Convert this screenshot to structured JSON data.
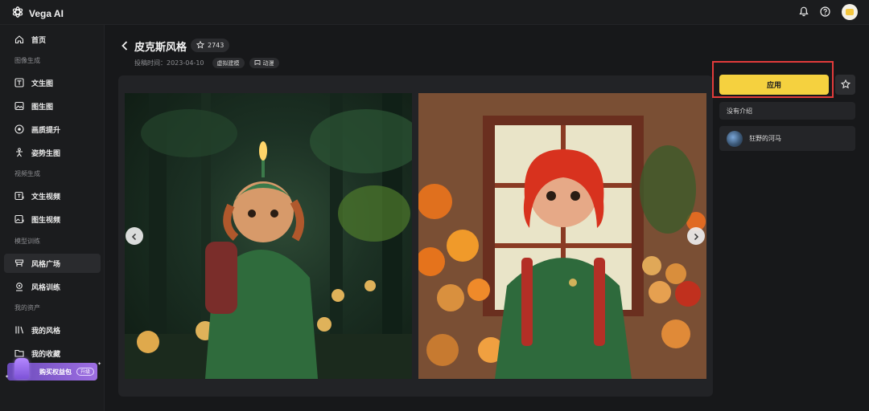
{
  "app": {
    "name": "Vega AI"
  },
  "sidebar": {
    "items": [
      {
        "label": "首页",
        "icon": "home-icon"
      },
      {
        "section": "图像生成"
      },
      {
        "label": "文生图",
        "icon": "text-icon"
      },
      {
        "label": "图生图",
        "icon": "image-icon"
      },
      {
        "label": "画质提升",
        "icon": "enhance-icon"
      },
      {
        "label": "姿势生图",
        "icon": "pose-icon"
      },
      {
        "section": "视频生成"
      },
      {
        "label": "文生视频",
        "icon": "text-video-icon"
      },
      {
        "label": "图生视频",
        "icon": "image-video-icon"
      },
      {
        "section": "模型训练"
      },
      {
        "label": "风格广场",
        "icon": "style-plaza-icon",
        "active": true
      },
      {
        "label": "风格训练",
        "icon": "style-train-icon"
      },
      {
        "section": "我的资产"
      },
      {
        "label": "我的风格",
        "icon": "my-style-icon"
      },
      {
        "label": "我的收藏",
        "icon": "folder-icon"
      }
    ],
    "promo": {
      "label": "购买权益包",
      "badge": "升级"
    }
  },
  "detail": {
    "title": "皮克斯风格",
    "star_count": "2743",
    "meta_label": "投稿时间：",
    "meta_date": "2023-04-10",
    "tags": [
      "虚拟建模",
      "动漫"
    ]
  },
  "side_panel": {
    "apply_label": "应用",
    "intro": "没有介绍",
    "author": "狂野的河马"
  },
  "colors": {
    "accent": "#f5d13f",
    "highlight": "#e23b3b",
    "background": "#17181a"
  }
}
